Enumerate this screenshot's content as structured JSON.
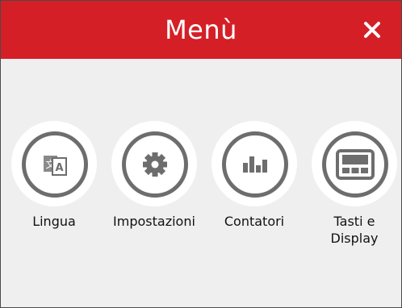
{
  "header": {
    "title": "Menù",
    "close_icon": "close-icon",
    "background_color": "#d51f26"
  },
  "menu": {
    "items": [
      {
        "label": "Lingua",
        "icon": "translate-icon"
      },
      {
        "label": "Impostazioni",
        "icon": "gear-icon"
      },
      {
        "label": "Contatori",
        "icon": "bar-chart-icon"
      },
      {
        "label": "Tasti e\nDisplay",
        "icon": "keyboard-display-icon"
      }
    ]
  },
  "colors": {
    "accent": "#d51f26",
    "icon_gray": "#6d6d6d",
    "panel_bg": "#efefef"
  }
}
